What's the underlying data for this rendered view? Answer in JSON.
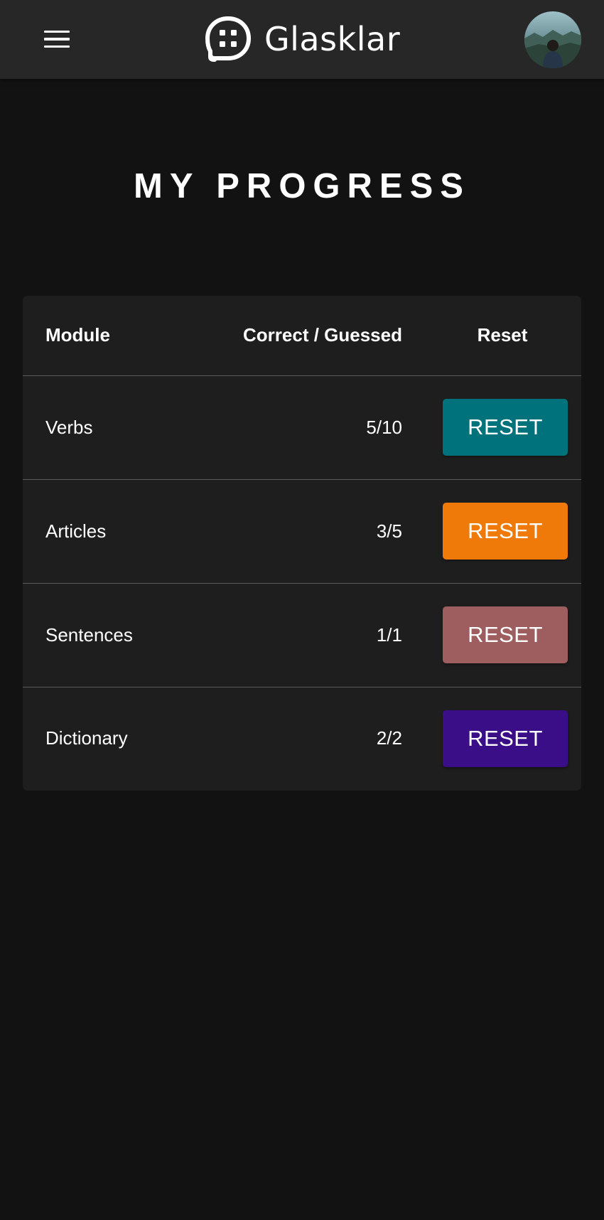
{
  "header": {
    "brand_name": "Glasklar",
    "menu_icon": "hamburger-menu-icon",
    "logo_icon": "chat-bubble-grid-icon",
    "background": "#272727"
  },
  "page": {
    "title": "MY PROGRESS",
    "background": "#121212"
  },
  "table": {
    "headers": {
      "module": "Module",
      "score": "Correct / Guessed",
      "reset": "Reset"
    },
    "rows": [
      {
        "module": "Verbs",
        "score": "5/10",
        "button_label": "RESET",
        "button_color": "#00727b"
      },
      {
        "module": "Articles",
        "score": "3/5",
        "button_label": "RESET",
        "button_color": "#ef7a09"
      },
      {
        "module": "Sentences",
        "score": "1/1",
        "button_label": "RESET",
        "button_color": "#9e5e60"
      },
      {
        "module": "Dictionary",
        "score": "2/2",
        "button_label": "RESET",
        "button_color": "#3a0e86"
      }
    ]
  }
}
